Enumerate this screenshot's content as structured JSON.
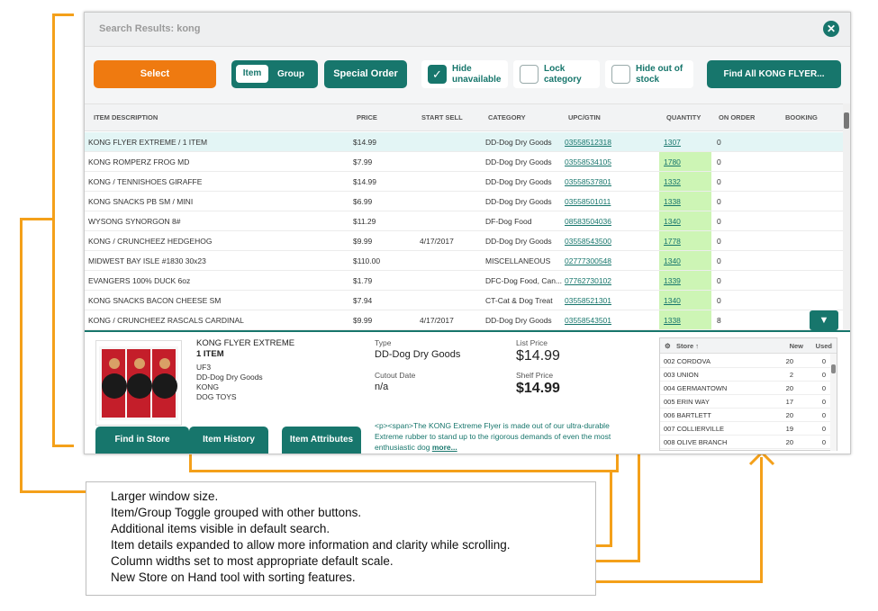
{
  "window": {
    "title": "Search Results: kong"
  },
  "toolbar": {
    "select_label": "Select",
    "toggle_item_label": "Item",
    "toggle_group_label": "Group",
    "special_order_label": "Special Order",
    "hide_unavailable_label": "Hide unavailable",
    "hide_unavailable_checked": true,
    "lock_category_label": "Lock category",
    "lock_category_checked": false,
    "hide_out_of_stock_label": "Hide out of stock",
    "hide_out_of_stock_checked": false,
    "find_all_label": "Find All KONG FLYER..."
  },
  "grid": {
    "columns": [
      "ITEM DESCRIPTION",
      "PRICE",
      "START SELL",
      "CATEGORY",
      "UPC/GTIN",
      "QUANTITY",
      "ON ORDER",
      "BOOKING"
    ],
    "rows": [
      {
        "desc": "KONG FLYER EXTREME / 1 ITEM",
        "price": "$14.99",
        "start": "",
        "category": "DD-Dog Dry Goods",
        "upc": "03558512318",
        "qty": "1307",
        "on_order": "0",
        "booking": ""
      },
      {
        "desc": "KONG ROMPERZ FROG MD",
        "price": "$7.99",
        "start": "",
        "category": "DD-Dog Dry Goods",
        "upc": "03558534105",
        "qty": "1780",
        "on_order": "0",
        "booking": ""
      },
      {
        "desc": "KONG / TENNISHOES GIRAFFE",
        "price": "$14.99",
        "start": "",
        "category": "DD-Dog Dry Goods",
        "upc": "03558537801",
        "qty": "1332",
        "on_order": "0",
        "booking": ""
      },
      {
        "desc": "KONG SNACKS PB SM / MINI",
        "price": "$6.99",
        "start": "",
        "category": "DD-Dog Dry Goods",
        "upc": "03558501011",
        "qty": "1338",
        "on_order": "0",
        "booking": ""
      },
      {
        "desc": "WYSONG SYNORGON 8#",
        "price": "$11.29",
        "start": "",
        "category": "DF-Dog Food",
        "upc": "08583504036",
        "qty": "1340",
        "on_order": "0",
        "booking": ""
      },
      {
        "desc": "KONG / CRUNCHEEZ HEDGEHOG",
        "price": "$9.99",
        "start": "4/17/2017",
        "category": "DD-Dog Dry Goods",
        "upc": "03558543500",
        "qty": "1778",
        "on_order": "0",
        "booking": ""
      },
      {
        "desc": "MIDWEST BAY ISLE #1830 30x23",
        "price": "$110.00",
        "start": "",
        "category": "MISCELLANEOUS",
        "upc": "02777300548",
        "qty": "1340",
        "on_order": "0",
        "booking": ""
      },
      {
        "desc": "EVANGERS 100% DUCK 6oz",
        "price": "$1.79",
        "start": "",
        "category": "DFC-Dog Food, Can...",
        "upc": "07762730102",
        "qty": "1339",
        "on_order": "0",
        "booking": ""
      },
      {
        "desc": "KONG SNACKS BACON CHEESE SM",
        "price": "$7.94",
        "start": "",
        "category": "CT-Cat & Dog Treat",
        "upc": "03558521301",
        "qty": "1340",
        "on_order": "0",
        "booking": ""
      },
      {
        "desc": "KONG / CRUNCHEEZ RASCALS CARDINAL",
        "price": "$9.99",
        "start": "4/17/2017",
        "category": "DD-Dog Dry Goods",
        "upc": "03558543501",
        "qty": "1338",
        "on_order": "8",
        "booking": ""
      }
    ],
    "scroll_down_icon": "▼"
  },
  "details": {
    "name": "KONG FLYER EXTREME",
    "qty": "1 ITEM",
    "lines": [
      "UF3",
      "DD-Dog Dry Goods",
      "KONG",
      "DOG TOYS"
    ],
    "type_label": "Type",
    "type_value": "DD-Dog Dry Goods",
    "cutout_label": "Cutout Date",
    "cutout_value": "n/a",
    "list_price_label": "List Price",
    "list_price_value": "$14.99",
    "shelf_price_label": "Shelf Price",
    "shelf_price_value": "$14.99",
    "description": "<p><span>The KONG Extreme Flyer is made out of our ultra-durable Extreme rubber to stand up to the rigorous demands of even the most enthusiastic dog",
    "more_label": "more...",
    "find_in_store_label": "Find in Store",
    "item_history_label": "Item History",
    "item_attributes_label": "Item Attributes"
  },
  "stores": {
    "header_store": "Store ↑",
    "header_new": "New",
    "header_used": "Used",
    "rows": [
      {
        "name": "002 CORDOVA",
        "new": "20",
        "used": "0"
      },
      {
        "name": "003 UNION",
        "new": "2",
        "used": "0"
      },
      {
        "name": "004 GERMANTOWN",
        "new": "20",
        "used": "0"
      },
      {
        "name": "005 ERIN WAY",
        "new": "17",
        "used": "0"
      },
      {
        "name": "006 BARTLETT",
        "new": "20",
        "used": "0"
      },
      {
        "name": "007 COLLIERVILLE",
        "new": "19",
        "used": "0"
      },
      {
        "name": "008 OLIVE BRANCH",
        "new": "20",
        "used": "0"
      }
    ]
  },
  "notes": [
    "Larger window size.",
    "Item/Group Toggle grouped with other buttons.",
    "Additional items visible in default search.",
    "Item details expanded to allow more information and clarity while scrolling.",
    "Column widths set to most appropriate default scale.",
    "New Store on Hand tool with sorting features."
  ],
  "colors": {
    "accent": "#17766c",
    "select": "#ef7a10",
    "annotation": "#f4a01a",
    "quantity_bg": "#cdf5b5"
  }
}
